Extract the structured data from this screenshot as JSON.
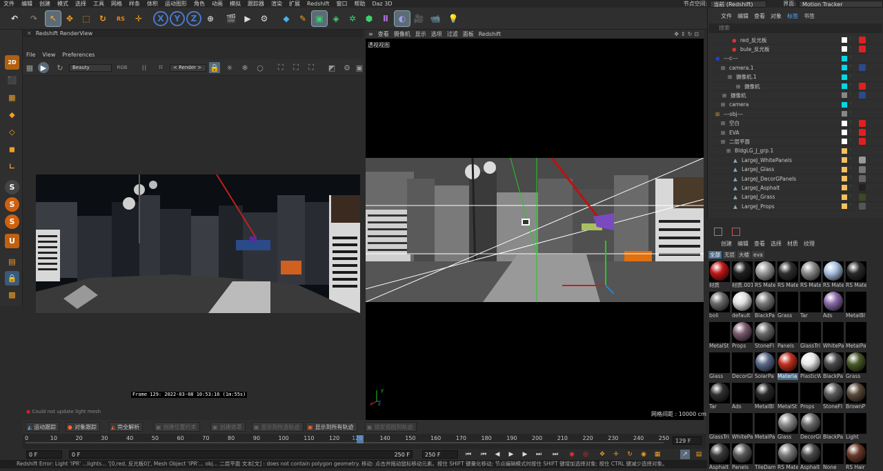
{
  "menubar": {
    "items": [
      "文件",
      "编辑",
      "创建",
      "模式",
      "选择",
      "工具",
      "网格",
      "样条",
      "体积",
      "运动图形",
      "角色",
      "动画",
      "模拟",
      "跟踪器",
      "渲染",
      "扩展",
      "Redshift",
      "窗口",
      "帮助",
      "Daz 3D"
    ],
    "node_space_label": "节点空间:",
    "node_space_value": "当前 (Redshift)",
    "layout_label": "界面:",
    "layout_value": "Motion Tracker"
  },
  "toolbar": {
    "icons": [
      "undo-icon",
      "redo-icon",
      "live-select-icon",
      "move-icon",
      "scale-icon",
      "rotate-icon",
      "recent-icon",
      "axis-x-icon",
      "axis-y-icon",
      "axis-z-icon",
      "coord-system-icon",
      "render-region-icon",
      "render-view-icon",
      "render-settings-icon",
      "cube-icon",
      "pen-icon",
      "sds-icon",
      "extrude-icon",
      "cloner-icon",
      "instance-icon",
      "deformer-icon",
      "field-icon",
      "camera-icon",
      "light-icon"
    ]
  },
  "renderview": {
    "tab_title": "Redshift RenderView",
    "menu": [
      "File",
      "View",
      "Preferences"
    ],
    "aov_value": "Beauty",
    "camera_value": "< Render >",
    "frame_info": "Frame  129:  2022-03-08  10:53:16  (1m:55s)",
    "status_text": "Could not update light mesh"
  },
  "viewport": {
    "menu": [
      "查看",
      "摄像机",
      "显示",
      "选项",
      "过滤",
      "面板",
      "Redshift"
    ],
    "label": "透视视图",
    "grid_text": "网格间距 : 10000 cm"
  },
  "object_manager": {
    "tabs": [
      "文件",
      "编辑",
      "查看",
      "对象",
      "标签",
      "书签"
    ],
    "search_placeholder": "搜索",
    "rows": [
      {
        "name": "red_反光板",
        "swatch": "#ffffff",
        "tag": "#e02020"
      },
      {
        "name": "bule_反光板",
        "swatch": "#ffffff",
        "tag": "#e02020"
      },
      {
        "name": "---c---",
        "swatch": "#00d8e8",
        "tag": ""
      },
      {
        "name": "camera.1",
        "swatch": "#00d8e8",
        "tag": "#2a4a8a"
      },
      {
        "name": "摄像机.1",
        "swatch": "#00d8e8",
        "tag": ""
      },
      {
        "name": "摄像机",
        "swatch": "#00d8e8",
        "tag": "#e02020"
      },
      {
        "name": "摄像机",
        "swatch": "#888888",
        "tag": "#2a4a8a"
      },
      {
        "name": "camera",
        "swatch": "#00d8e8",
        "tag": ""
      },
      {
        "name": "---obj---",
        "swatch": "#888888",
        "tag": ""
      },
      {
        "name": "空白",
        "swatch": "#ffffff",
        "tag": "#e02020"
      },
      {
        "name": "EVA",
        "swatch": "#ffffff",
        "tag": "#e02020"
      },
      {
        "name": "二层平面",
        "swatch": "#ffffff",
        "tag": "#e02020"
      },
      {
        "name": "BldgLG_J_grp.1",
        "swatch": "#f5c060",
        "tag": ""
      },
      {
        "name": "LargeJ_WhitePanels",
        "swatch": "#f5c060",
        "tag": "#999999"
      },
      {
        "name": "LargeJ_Glass",
        "swatch": "#f5c060",
        "tag": "#777777"
      },
      {
        "name": "LargeJ_DecorGPanels",
        "swatch": "#f5c060",
        "tag": "#666666"
      },
      {
        "name": "LargeJ_Asphalt",
        "swatch": "#f5c060",
        "tag": "#222222"
      },
      {
        "name": "LargeJ_Grass",
        "swatch": "#f5c060",
        "tag": "#3a4a22"
      },
      {
        "name": "LargeJ_Props",
        "swatch": "#f5c060",
        "tag": "#555555"
      }
    ]
  },
  "material_manager": {
    "menu": [
      "创建",
      "编辑",
      "查看",
      "选择",
      "材质",
      "纹理"
    ],
    "filters": [
      "全部",
      "无层",
      "大楼",
      "eva"
    ],
    "materials": [
      {
        "name": "材质",
        "color": "#c01818"
      },
      {
        "name": "材质.001",
        "color": "#202020"
      },
      {
        "name": "RS Mate",
        "color": "#9a9a9a"
      },
      {
        "name": "RS Mate",
        "color": "#303030"
      },
      {
        "name": "RS Mate",
        "color": "#8a8a8a"
      },
      {
        "name": "RS Mate",
        "color": "#a8c0e0"
      },
      {
        "name": "RS Mate",
        "color": "#2a2a2a"
      },
      {
        "name": "boli",
        "color": "#6a6a6a"
      },
      {
        "name": "default",
        "color": "#e0e0e0"
      },
      {
        "name": "BlackPa",
        "color": "#7a7a7a"
      },
      {
        "name": "Grass",
        "color": "#000000"
      },
      {
        "name": "Tar",
        "color": "#000000"
      },
      {
        "name": "Ads",
        "color": "#8a6aa8"
      },
      {
        "name": "MetalBl",
        "color": "#000000"
      },
      {
        "name": "MetalSt",
        "color": "#000000"
      },
      {
        "name": "Props",
        "color": "#7a5a70"
      },
      {
        "name": "StoneFl",
        "color": "#6a6a6a"
      },
      {
        "name": "Panels",
        "color": "#000000"
      },
      {
        "name": "GlassTri",
        "color": "#000000"
      },
      {
        "name": "WhitePa",
        "color": "#000000"
      },
      {
        "name": "MetalPa",
        "color": "#000000"
      },
      {
        "name": "Glass",
        "color": "#000000"
      },
      {
        "name": "DecorGl",
        "color": "#000000"
      },
      {
        "name": "SolarPa",
        "color": "#5a6a8a"
      },
      {
        "name": "Materia",
        "color": "#c03020"
      },
      {
        "name": "PlasticW",
        "color": "#e8e8e8"
      },
      {
        "name": "BlackPa",
        "color": "#4a4a4a"
      },
      {
        "name": "Grass",
        "color": "#4a5a2a"
      },
      {
        "name": "Tar",
        "color": "#303030"
      },
      {
        "name": "Ads",
        "color": "#000000"
      },
      {
        "name": "MetalBl",
        "color": "#2a2a2a"
      },
      {
        "name": "MetalSt",
        "color": "#000000"
      },
      {
        "name": "Props",
        "color": "#000000"
      },
      {
        "name": "StoneFl",
        "color": "#5a5a5a"
      },
      {
        "name": "BrownP",
        "color": "#5a4a3a"
      },
      {
        "name": "GlassTri",
        "color": "#000000"
      },
      {
        "name": "WhitePa",
        "color": "#000000"
      },
      {
        "name": "MetalPa",
        "color": "#000000"
      },
      {
        "name": "Glass",
        "color": "#8a8a8a"
      },
      {
        "name": "DecorGl",
        "color": "#6a6a6a"
      },
      {
        "name": "BlackPa",
        "color": "#000000"
      },
      {
        "name": "Light",
        "color": "#000000"
      },
      {
        "name": "Asphalt",
        "color": "#3a3a3a"
      },
      {
        "name": "Panels",
        "color": "#5a5a5a"
      },
      {
        "name": "TileDam",
        "color": "#000000"
      },
      {
        "name": "RS Mate",
        "color": "#7a7a7a"
      },
      {
        "name": "Asphalt",
        "color": "#4a4a4a"
      },
      {
        "name": "None",
        "color": "#000000"
      },
      {
        "name": "RS Hair",
        "color": "#6a3a2a"
      }
    ]
  },
  "animbar": {
    "buttons": [
      "运动跟踪",
      "对象跟踪",
      "完全解析",
      "创建位置约束",
      "创建遮罩",
      "显示到所选轨迹",
      "显示到所有轨迹",
      "锁定视图到轨迹"
    ]
  },
  "timeline": {
    "ticks": [
      "0",
      "10",
      "20",
      "30",
      "40",
      "50",
      "60",
      "70",
      "80",
      "90",
      "100",
      "110",
      "120",
      "129",
      "140",
      "150",
      "160",
      "170",
      "180",
      "190",
      "200",
      "210",
      "220",
      "230",
      "240",
      "250"
    ],
    "current_frame": "129 F",
    "start_field": "0 F",
    "preview_start": "0 F",
    "preview_end": "250 F",
    "end_field": "250 F"
  },
  "statusbar": {
    "text": "Redshift Error: Light 'IPR' ...lights...  '[0,red, 反光板0]', Mesh Object 'IPR'... obj...  二层平面 文本[文] : does not contain polygon geometry.   移动: 点击并拖动鼠标移动元素。按住 SHIFT 键量化移动; 节点编辑模式时按住 SHIFT 键增加选择对象; 按住 CTRL 键减少选择对象。"
  }
}
